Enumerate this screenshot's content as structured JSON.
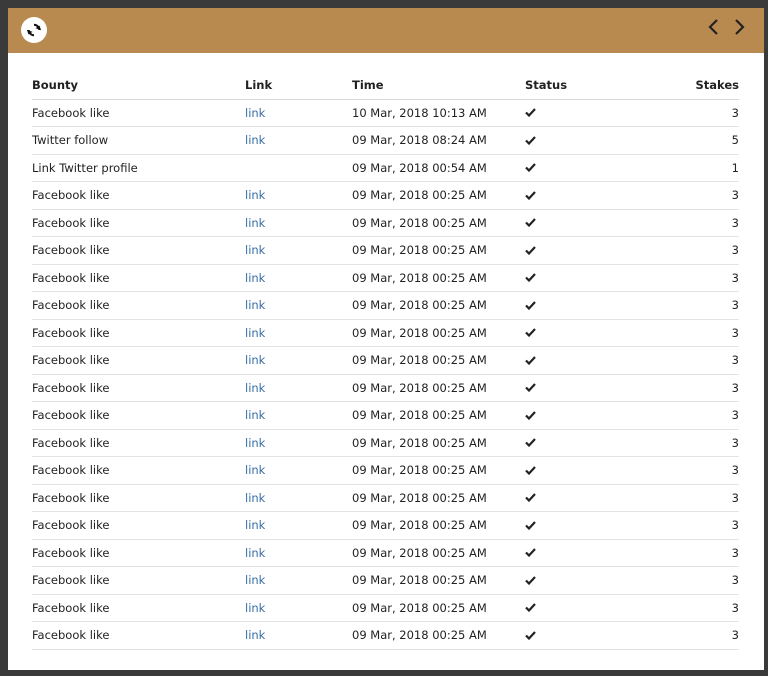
{
  "colors": {
    "accent": "#b88a50",
    "link": "#3a6ea5"
  },
  "toolbar": {
    "refresh_icon": "refresh-icon",
    "prev_icon": "chevron-left-icon",
    "next_icon": "chevron-right-icon"
  },
  "table": {
    "headers": {
      "bounty": "Bounty",
      "link": "Link",
      "time": "Time",
      "status": "Status",
      "stakes": "Stakes"
    },
    "rows": [
      {
        "bounty": "Facebook like",
        "link": "link",
        "time": "10 Mar, 2018 10:13 AM",
        "status": "check-icon",
        "stakes": "3"
      },
      {
        "bounty": "Twitter follow",
        "link": "link",
        "time": "09 Mar, 2018 08:24 AM",
        "status": "check-icon",
        "stakes": "5"
      },
      {
        "bounty": "Link Twitter profile",
        "link": "",
        "time": "09 Mar, 2018 00:54 AM",
        "status": "check-icon",
        "stakes": "1"
      },
      {
        "bounty": "Facebook like",
        "link": "link",
        "time": "09 Mar, 2018 00:25 AM",
        "status": "check-icon",
        "stakes": "3"
      },
      {
        "bounty": "Facebook like",
        "link": "link",
        "time": "09 Mar, 2018 00:25 AM",
        "status": "check-icon",
        "stakes": "3"
      },
      {
        "bounty": "Facebook like",
        "link": "link",
        "time": "09 Mar, 2018 00:25 AM",
        "status": "check-icon",
        "stakes": "3"
      },
      {
        "bounty": "Facebook like",
        "link": "link",
        "time": "09 Mar, 2018 00:25 AM",
        "status": "check-icon",
        "stakes": "3"
      },
      {
        "bounty": "Facebook like",
        "link": "link",
        "time": "09 Mar, 2018 00:25 AM",
        "status": "check-icon",
        "stakes": "3"
      },
      {
        "bounty": "Facebook like",
        "link": "link",
        "time": "09 Mar, 2018 00:25 AM",
        "status": "check-icon",
        "stakes": "3"
      },
      {
        "bounty": "Facebook like",
        "link": "link",
        "time": "09 Mar, 2018 00:25 AM",
        "status": "check-icon",
        "stakes": "3"
      },
      {
        "bounty": "Facebook like",
        "link": "link",
        "time": "09 Mar, 2018 00:25 AM",
        "status": "check-icon",
        "stakes": "3"
      },
      {
        "bounty": "Facebook like",
        "link": "link",
        "time": "09 Mar, 2018 00:25 AM",
        "status": "check-icon",
        "stakes": "3"
      },
      {
        "bounty": "Facebook like",
        "link": "link",
        "time": "09 Mar, 2018 00:25 AM",
        "status": "check-icon",
        "stakes": "3"
      },
      {
        "bounty": "Facebook like",
        "link": "link",
        "time": "09 Mar, 2018 00:25 AM",
        "status": "check-icon",
        "stakes": "3"
      },
      {
        "bounty": "Facebook like",
        "link": "link",
        "time": "09 Mar, 2018 00:25 AM",
        "status": "check-icon",
        "stakes": "3"
      },
      {
        "bounty": "Facebook like",
        "link": "link",
        "time": "09 Mar, 2018 00:25 AM",
        "status": "check-icon",
        "stakes": "3"
      },
      {
        "bounty": "Facebook like",
        "link": "link",
        "time": "09 Mar, 2018 00:25 AM",
        "status": "check-icon",
        "stakes": "3"
      },
      {
        "bounty": "Facebook like",
        "link": "link",
        "time": "09 Mar, 2018 00:25 AM",
        "status": "check-icon",
        "stakes": "3"
      },
      {
        "bounty": "Facebook like",
        "link": "link",
        "time": "09 Mar, 2018 00:25 AM",
        "status": "check-icon",
        "stakes": "3"
      },
      {
        "bounty": "Facebook like",
        "link": "link",
        "time": "09 Mar, 2018 00:25 AM",
        "status": "check-icon",
        "stakes": "3"
      }
    ]
  }
}
